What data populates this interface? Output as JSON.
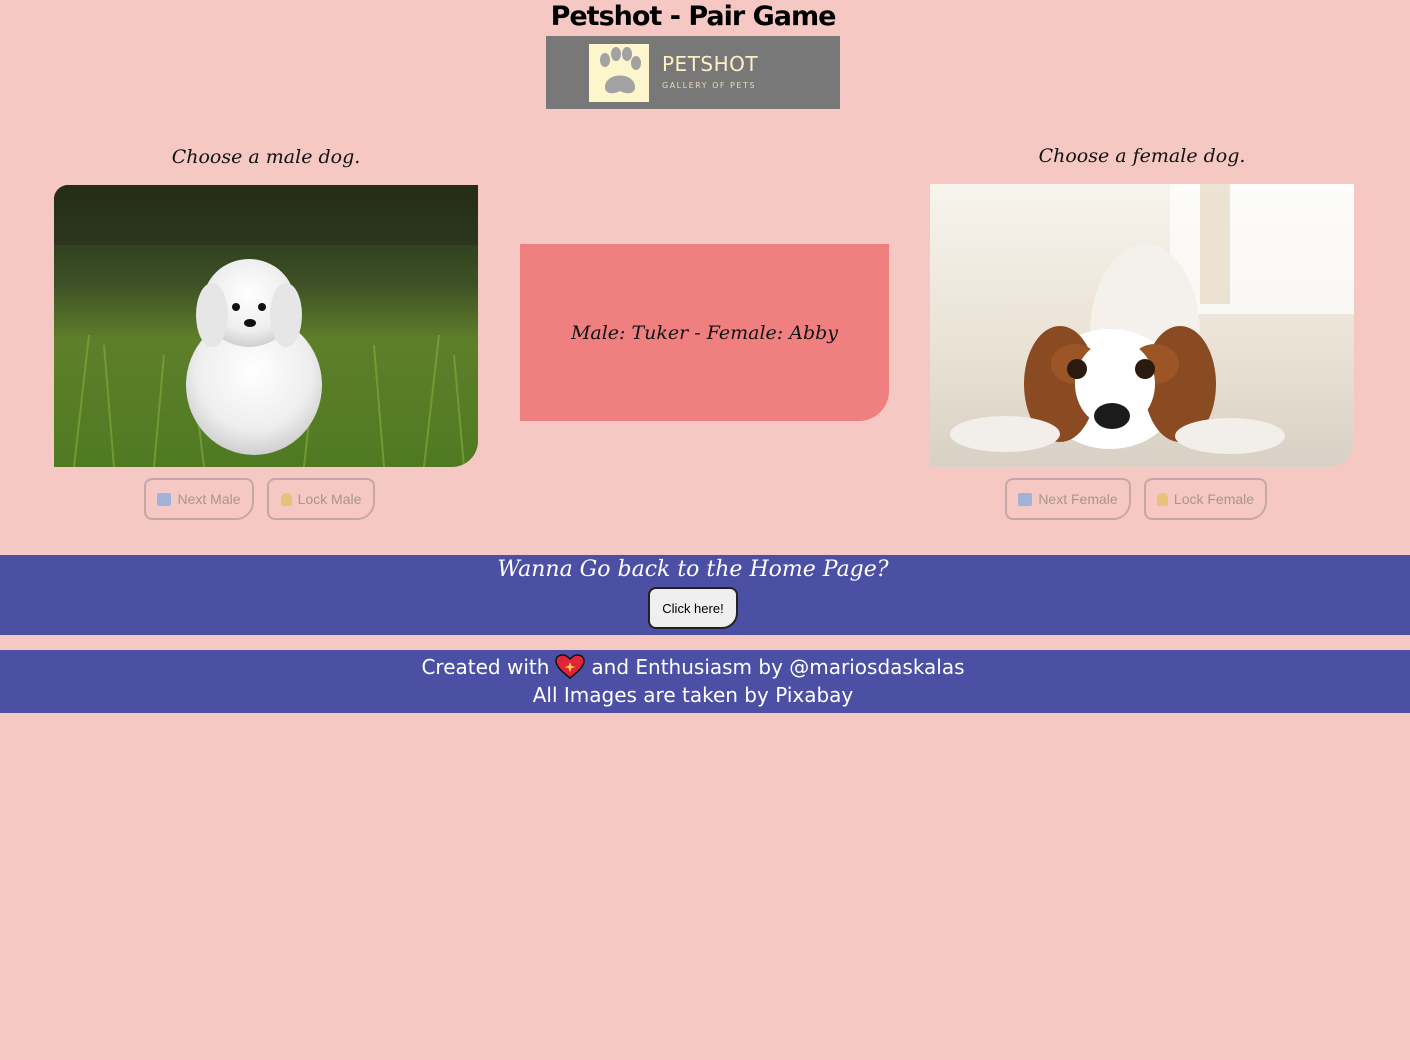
{
  "header": {
    "title": "Petshot - Pair Game",
    "logo": {
      "name": "PETSHOT",
      "tagline": "GALLERY OF PETS",
      "icon": "paw-icon"
    }
  },
  "male": {
    "prompt": "Choose a male dog.",
    "photo_icon": "white-maltese-puppy-photo",
    "next_label": "Next Male",
    "lock_label": "Lock Male"
  },
  "female": {
    "prompt": "Choose a female dog.",
    "photo_icon": "cavalier-spaniel-photo",
    "next_label": "Next Female",
    "lock_label": "Lock Female"
  },
  "result": {
    "text": "Male: Tuker - Female: Abby"
  },
  "home": {
    "question": "Wanna Go back to the Home Page?",
    "button_label": "Click here!"
  },
  "footer": {
    "created_prefix": "Created with",
    "created_suffix": "and Enthusiasm by @mariosdaskalas",
    "heart_icon": "sparkling-heart-icon",
    "credits": "All Images are taken by Pixabay"
  },
  "colors": {
    "background": "#f5c8c3",
    "result_box": "#f08080",
    "band": "#4b50a5",
    "logo_bg": "#787878"
  }
}
